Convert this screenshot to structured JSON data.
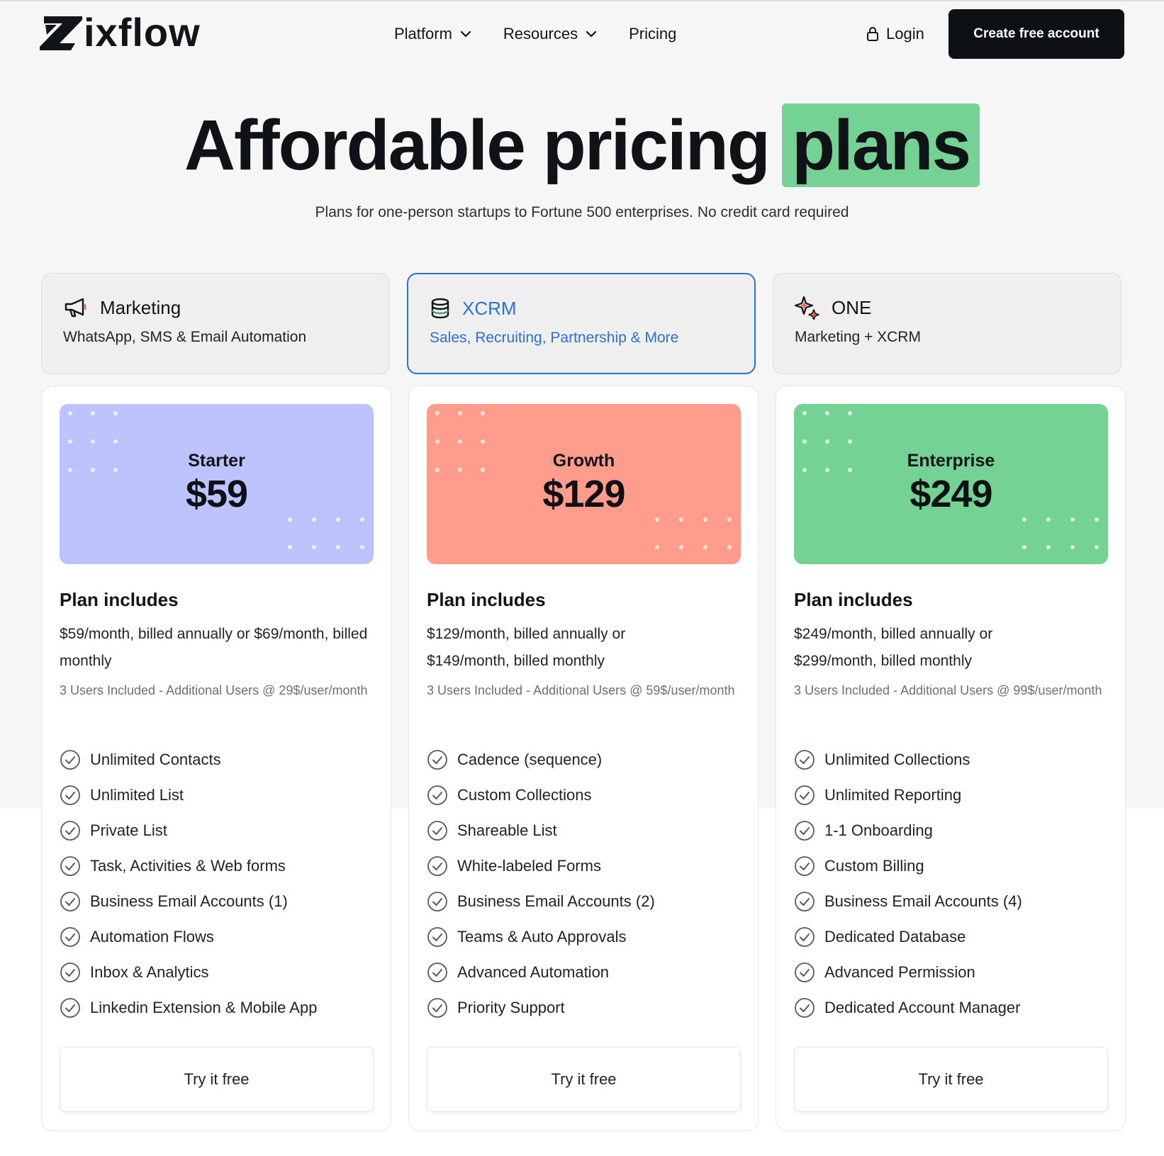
{
  "brand": {
    "name": "ixflow",
    "accent": "#74d394",
    "dark": "#0d1014",
    "active_blue": "#2a6fdb"
  },
  "nav": {
    "items": [
      {
        "label": "Platform",
        "has_dropdown": true
      },
      {
        "label": "Resources",
        "has_dropdown": true
      },
      {
        "label": "Pricing",
        "has_dropdown": false
      }
    ],
    "login_label": "Login",
    "cta_label": "Create free account"
  },
  "hero": {
    "title_main": "Affordable pricing",
    "title_highlight": "plans",
    "subtitle": "Plans for one-person startups to Fortune 500 enterprises. No credit card required"
  },
  "product_tabs": [
    {
      "name": "Marketing",
      "description": "WhatsApp, SMS & Email Automation",
      "icon": "megaphone-icon",
      "active": false
    },
    {
      "name": "XCRM",
      "description": "Sales, Recruiting, Partnership & More",
      "icon": "database-icon",
      "active": true
    },
    {
      "name": "ONE",
      "description": "Marketing + XCRM",
      "icon": "sparkle-icon",
      "active": false
    }
  ],
  "plans": [
    {
      "tier": "Starter",
      "price": "$59",
      "color": "#bcc3ff",
      "includes_label": "Plan includes",
      "billing": "$59/month, billed annually or $69/month, billed monthly",
      "users": "3 Users Included - Additional Users @ 29$/user/month",
      "features": [
        "Unlimited Contacts",
        "Unlimited List",
        "Private List",
        "Task, Activities & Web forms",
        "Business Email Accounts (1)",
        "Automation Flows",
        "Inbox & Analytics",
        "Linkedin Extension & Mobile App"
      ],
      "button_label": "Try it free"
    },
    {
      "tier": "Growth",
      "price": "$129",
      "color": "#ff9c8b",
      "includes_label": "Plan includes",
      "billing": "$129/month, billed annually or $149/month, billed monthly",
      "users": "3 Users Included - Additional Users @ 59$/user/month",
      "features": [
        "Cadence (sequence)",
        "Custom Collections",
        "Shareable List",
        "White-labeled Forms",
        "Business Email Accounts (2)",
        "Teams & Auto Approvals",
        "Advanced Automation",
        "Priority Support"
      ],
      "button_label": "Try it free"
    },
    {
      "tier": "Enterprise",
      "price": "$249",
      "color": "#74d394",
      "includes_label": "Plan includes",
      "billing": "$249/month, billed annually or $299/month, billed monthly",
      "users": "3 Users Included - Additional Users @ 99$/user/month",
      "features": [
        "Unlimited Collections",
        "Unlimited Reporting",
        "1-1 Onboarding",
        "Custom Billing",
        "Business Email Accounts (4)",
        "Dedicated Database",
        "Advanced Permission",
        "Dedicated Account Manager"
      ],
      "button_label": "Try it free"
    }
  ]
}
